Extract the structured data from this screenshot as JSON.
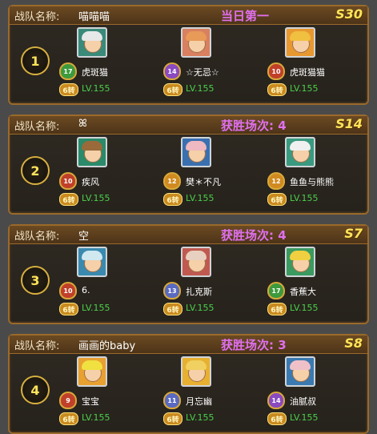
{
  "label_team_name": "战队名称:",
  "teams": [
    {
      "rank": "1",
      "name": "喵喵喵",
      "win_text": "当日第一",
      "server": "S30",
      "members": [
        {
          "name": "虎斑猫",
          "vip": "17",
          "zhuan": "6转",
          "level": "LV.155",
          "vip_color": "#3d9a3d",
          "hair": "#e8e8e8",
          "bg": "#3a8a7a"
        },
        {
          "name": "☆无忌☆",
          "vip": "14",
          "zhuan": "6转",
          "level": "LV.155",
          "vip_color": "#8a4ac0",
          "hair": "#e89a58",
          "bg": "#d88060"
        },
        {
          "name": "虎斑猫猫",
          "vip": "10",
          "zhuan": "6转",
          "level": "LV.155",
          "vip_color": "#c0402a",
          "hair": "#f0c040",
          "bg": "#e89830"
        }
      ]
    },
    {
      "rank": "2",
      "name": "ꕤ",
      "win_text": "获胜场次: 4",
      "server": "S14",
      "members": [
        {
          "name": "疾风",
          "vip": "10",
          "zhuan": "6转",
          "level": "LV.155",
          "vip_color": "#c0402a",
          "hair": "#9a6a3a",
          "bg": "#2a8a6a"
        },
        {
          "name": "樊＊不凡",
          "vip": "12",
          "zhuan": "6转",
          "level": "LV.155",
          "vip_color": "#d08a20",
          "hair": "#f0b8c0",
          "bg": "#3a70b0"
        },
        {
          "name": "鱼鱼与熊熊",
          "vip": "12",
          "zhuan": "6转",
          "level": "LV.155",
          "vip_color": "#d08a20",
          "hair": "#f0f0f0",
          "bg": "#3a9a80"
        }
      ]
    },
    {
      "rank": "3",
      "name": "空",
      "win_text": "获胜场次: 4",
      "server": "S7",
      "members": [
        {
          "name": "6.",
          "vip": "10",
          "zhuan": "6转",
          "level": "LV.155",
          "vip_color": "#c0402a",
          "hair": "#d0e8f0",
          "bg": "#3a8ab0"
        },
        {
          "name": "扎克斯",
          "vip": "13",
          "zhuan": "6转",
          "level": "LV.155",
          "vip_color": "#5a6ac0",
          "hair": "#e8d0c0",
          "bg": "#c05a50"
        },
        {
          "name": "香蕉大",
          "vip": "17",
          "zhuan": "6转",
          "level": "LV.155",
          "vip_color": "#3d9a3d",
          "hair": "#f0d040",
          "bg": "#3a9a60"
        }
      ]
    },
    {
      "rank": "4",
      "name": "画画的baby",
      "win_text": "获胜场次: 3",
      "server": "S8",
      "members": [
        {
          "name": "宝宝",
          "vip": "9",
          "zhuan": "6转",
          "level": "LV.155",
          "vip_color": "#c0402a",
          "hair": "#f0e040",
          "bg": "#e8a030"
        },
        {
          "name": "月忘幽",
          "vip": "11",
          "zhuan": "6转",
          "level": "LV.155",
          "vip_color": "#5a6ac0",
          "hair": "#f0d060",
          "bg": "#e8b030"
        },
        {
          "name": "油腻叔",
          "vip": "14",
          "zhuan": "6转",
          "level": "LV.155",
          "vip_color": "#8a4ac0",
          "hair": "#f0c0c8",
          "bg": "#3a7ab0"
        }
      ]
    }
  ]
}
